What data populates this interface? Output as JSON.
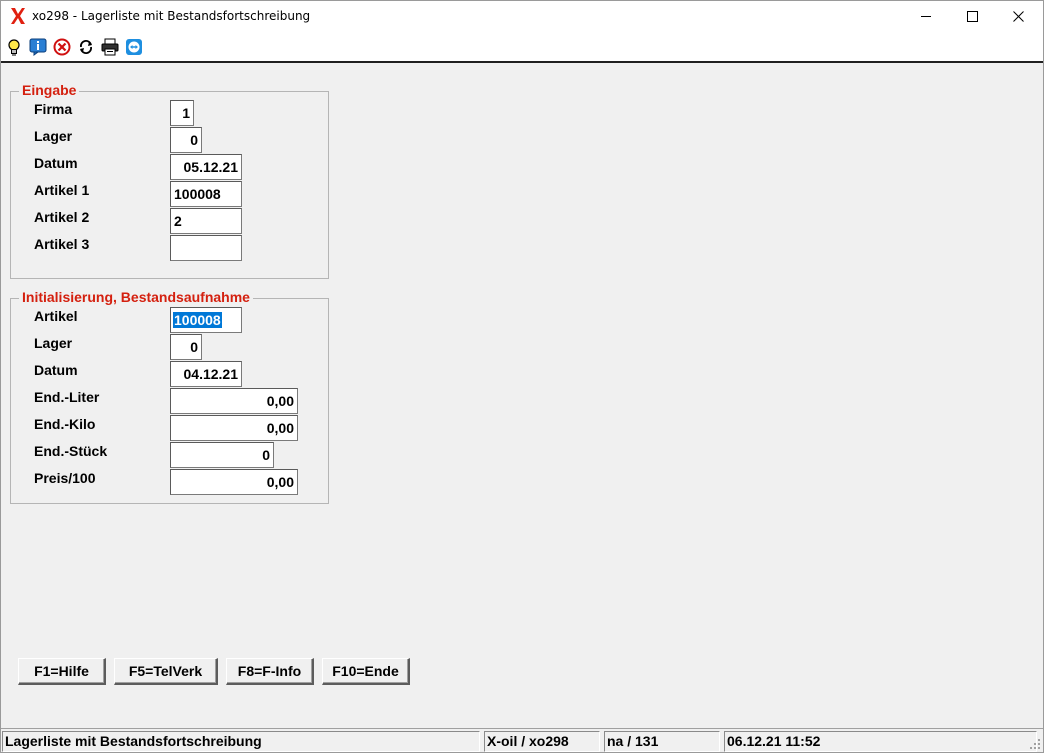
{
  "window": {
    "title": "xo298 - Lagerliste mit Bestandsfortschreibung",
    "minimize_glyph": "—",
    "maximize_glyph": "☐",
    "close_glyph": "✕"
  },
  "toolbar": {
    "icons": [
      "lightbulb-icon",
      "info-icon",
      "cancel-icon",
      "refresh-icon",
      "printer-icon",
      "teamviewer-icon"
    ]
  },
  "eingabe": {
    "title": "Eingabe",
    "fields": [
      {
        "label": "Firma",
        "value": "1"
      },
      {
        "label": "Lager",
        "value": "0"
      },
      {
        "label": "Datum",
        "value": "05.12.21"
      },
      {
        "label": "Artikel 1",
        "value": "100008"
      },
      {
        "label": "Artikel 2",
        "value": "2"
      },
      {
        "label": "Artikel 3",
        "value": ""
      }
    ]
  },
  "init": {
    "title": "Initialisierung, Bestandsaufnahme",
    "fields": [
      {
        "label": "Artikel",
        "value": "100008"
      },
      {
        "label": "Lager",
        "value": "0"
      },
      {
        "label": "Datum",
        "value": "04.12.21"
      },
      {
        "label": "End.-Liter",
        "value": "0,00"
      },
      {
        "label": "End.-Kilo",
        "value": "0,00"
      },
      {
        "label": "End.-Stück",
        "value": "0"
      },
      {
        "label": "Preis/100",
        "value": "0,00"
      }
    ]
  },
  "buttons": {
    "help": "F1=Hilfe",
    "telverk": "F5=TelVerk",
    "finfo": "F8=F-Info",
    "ende": "F10=Ende"
  },
  "status": {
    "description": "Lagerliste mit Bestandsfortschreibung",
    "program": "X-oil / xo298",
    "user": "na / 131",
    "datetime": "06.12.21 11:52"
  },
  "colors": {
    "group_title": "#d4200f",
    "selection": "#0078d7",
    "logo": "#e02010"
  }
}
